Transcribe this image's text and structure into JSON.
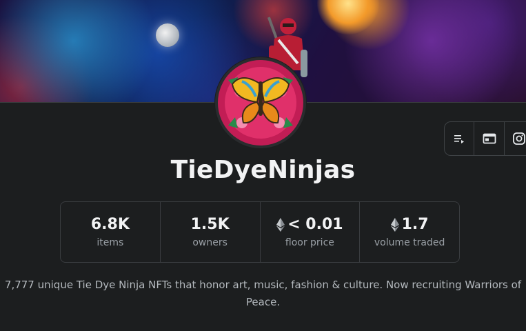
{
  "collection": {
    "name": "TieDyeNinjas",
    "description": "7,777 unique Tie Dye Ninja NFTs that honor art, music, fashion & culture. Now recruiting Warriors of Peace."
  },
  "stats": [
    {
      "value": "6.8K",
      "label": "items",
      "currency_icon": false
    },
    {
      "value": "1.5K",
      "label": "owners",
      "currency_icon": false
    },
    {
      "value": "< 0.01",
      "label": "floor price",
      "currency_icon": true
    },
    {
      "value": "1.7",
      "label": "volume traded",
      "currency_icon": true
    }
  ],
  "actions": [
    {
      "icon": "activity-list-icon"
    },
    {
      "icon": "website-icon"
    },
    {
      "icon": "instagram-icon"
    }
  ],
  "colors": {
    "background": "#1c1e1f",
    "text_primary": "#f2f3f4",
    "text_secondary": "#9aa0a6",
    "border": "#3a3d40"
  }
}
